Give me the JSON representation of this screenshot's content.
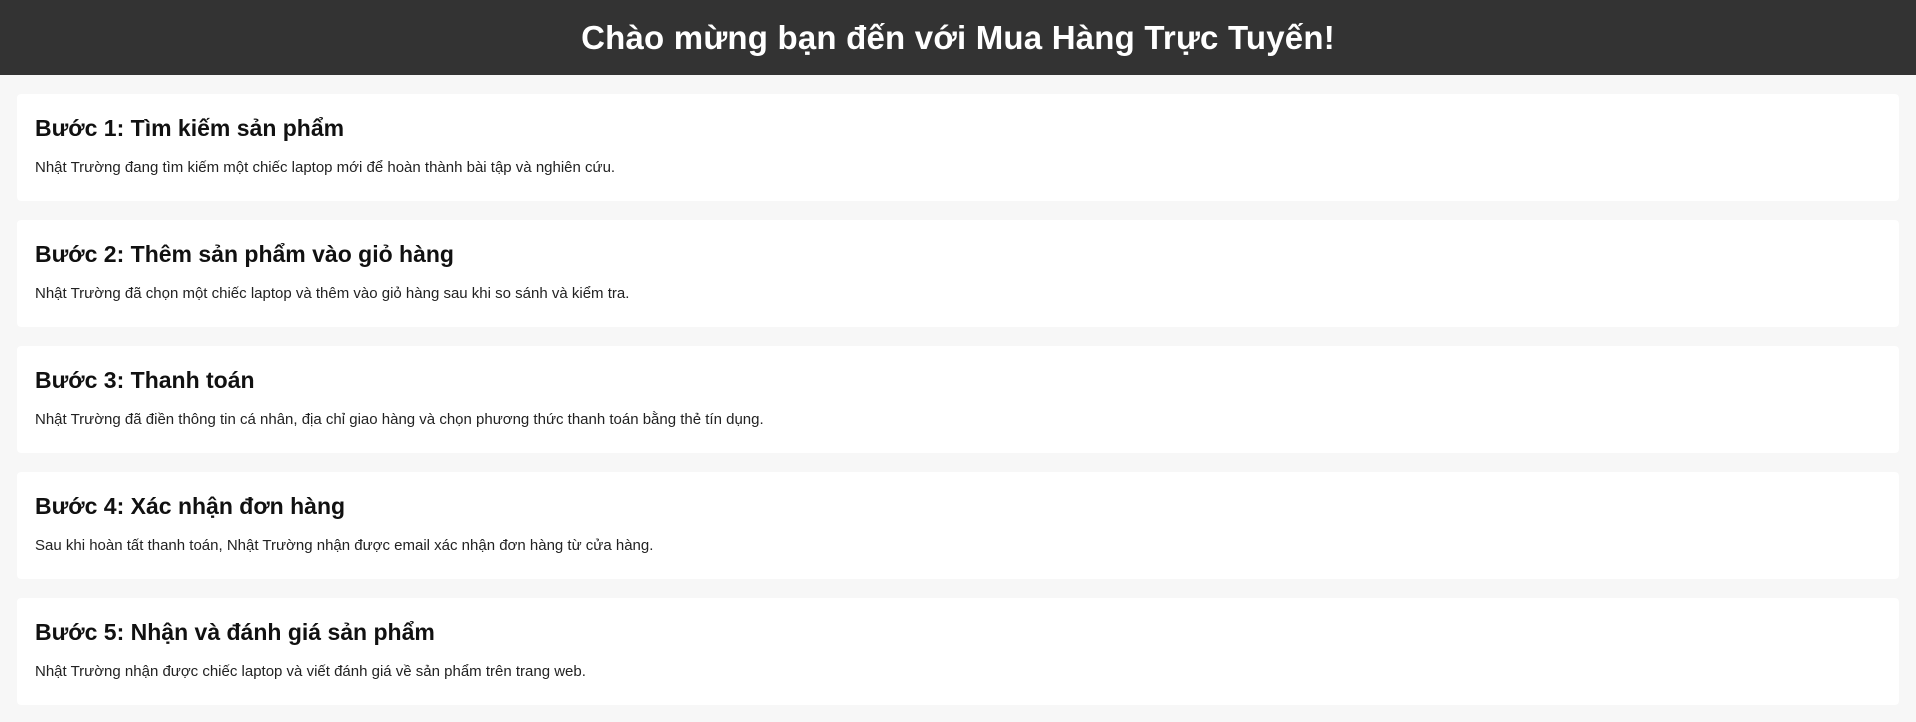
{
  "header": {
    "title": "Chào mừng bạn đến với Mua Hàng Trực Tuyến!"
  },
  "steps": [
    {
      "title": "Bước 1: Tìm kiếm sản phẩm",
      "description": "Nhật Trường đang tìm kiếm một chiếc laptop mới để hoàn thành bài tập và nghiên cứu."
    },
    {
      "title": "Bước 2: Thêm sản phẩm vào giỏ hàng",
      "description": "Nhật Trường đã chọn một chiếc laptop và thêm vào giỏ hàng sau khi so sánh và kiểm tra."
    },
    {
      "title": "Bước 3: Thanh toán",
      "description": "Nhật Trường đã điền thông tin cá nhân, địa chỉ giao hàng và chọn phương thức thanh toán bằng thẻ tín dụng."
    },
    {
      "title": "Bước 4: Xác nhận đơn hàng",
      "description": "Sau khi hoàn tất thanh toán, Nhật Trường nhận được email xác nhận đơn hàng từ cửa hàng."
    },
    {
      "title": "Bước 5: Nhận và đánh giá sản phẩm",
      "description": "Nhật Trường nhận được chiếc laptop và viết đánh giá về sản phẩm trên trang web."
    }
  ],
  "colors": {
    "header_background": "#333333",
    "header_text": "#ffffff",
    "page_background": "#f7f7f7",
    "card_background": "#ffffff"
  }
}
